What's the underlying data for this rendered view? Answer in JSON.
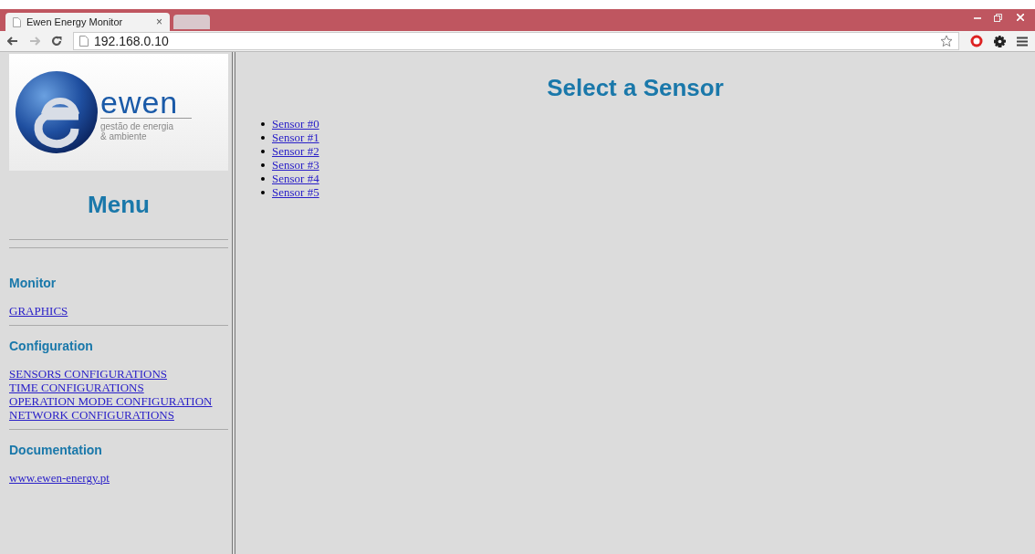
{
  "browser": {
    "tabs": [
      {
        "title": "Ewen Energy Monitor",
        "close": "×",
        "selected": true
      },
      {
        "selected": false
      }
    ],
    "address": "192.168.0.10"
  },
  "logo": {
    "wordmark": "ewen",
    "tagline": [
      "gestão de energia",
      "& ambiente"
    ]
  },
  "sidebar": {
    "title": "Menu",
    "sections": [
      {
        "heading": "Monitor",
        "links": [
          "GRAPHICS"
        ]
      },
      {
        "heading": "Configuration",
        "links": [
          "SENSORS CONFIGURATIONS",
          "TIME CONFIGURATIONS",
          "OPERATION MODE CONFIGURATION",
          "NETWORK CONFIGURATIONS"
        ]
      },
      {
        "heading": "Documentation",
        "links": [
          "www.ewen-energy.pt"
        ]
      }
    ]
  },
  "main": {
    "title": "Select a Sensor",
    "sensors": [
      "Sensor #0",
      "Sensor #1",
      "Sensor #2",
      "Sensor #3",
      "Sensor #4",
      "Sensor #5"
    ]
  }
}
